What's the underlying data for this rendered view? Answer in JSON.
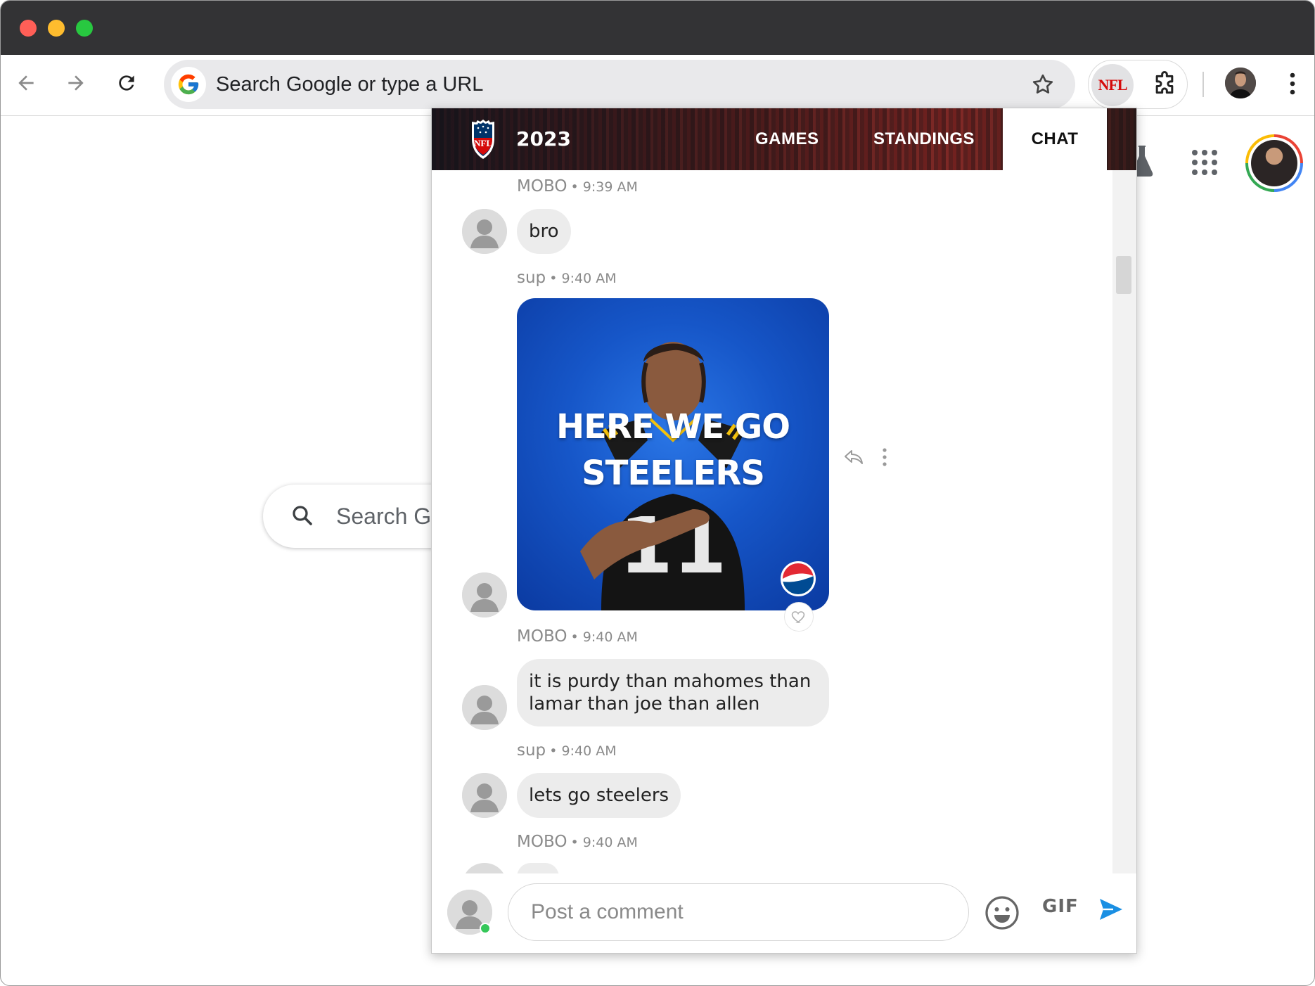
{
  "browser": {
    "omnibox_placeholder": "Search Google or type a URL",
    "extension_label": "NFL"
  },
  "ntp": {
    "search_placeholder": "Search Google or type a URL"
  },
  "popup": {
    "season": "2023",
    "tabs": [
      {
        "label": "GAMES",
        "active": false
      },
      {
        "label": "STANDINGS",
        "active": false
      },
      {
        "label": "CHAT",
        "active": true
      }
    ],
    "messages": [
      {
        "user": "MOBO",
        "time": "9:39 AM",
        "type": "text",
        "text": "bro"
      },
      {
        "user": "sup",
        "time": "9:40 AM",
        "type": "gif",
        "gif_text_line1": "HERE WE GO",
        "gif_text_line2": "STEELERS"
      },
      {
        "user": "MOBO",
        "time": "9:40 AM",
        "type": "text",
        "text_line1": "it is purdy than mahomes than",
        "text_line2": "lamar than joe than allen"
      },
      {
        "user": "sup",
        "time": "9:40 AM",
        "type": "text",
        "text": "lets go steelers"
      },
      {
        "user": "MOBO",
        "time": "9:40 AM",
        "type": "partial"
      }
    ],
    "composer": {
      "placeholder": "Post a comment",
      "gif_label": "GIF"
    }
  },
  "colors": {
    "nfl_red": "#d50a0a",
    "nfl_blue": "#013369",
    "send_blue": "#1a8fe3",
    "online_green": "#35c759"
  },
  "icons": [
    "back-arrow-icon",
    "forward-arrow-icon",
    "reload-icon",
    "google-g-icon",
    "bookmark-star-icon",
    "puzzle-icon",
    "kebab-menu-icon",
    "search-icon",
    "labs-flask-icon",
    "apps-grid-icon",
    "reply-icon",
    "more-vertical-icon",
    "heart-icon",
    "emoji-icon",
    "send-icon"
  ]
}
